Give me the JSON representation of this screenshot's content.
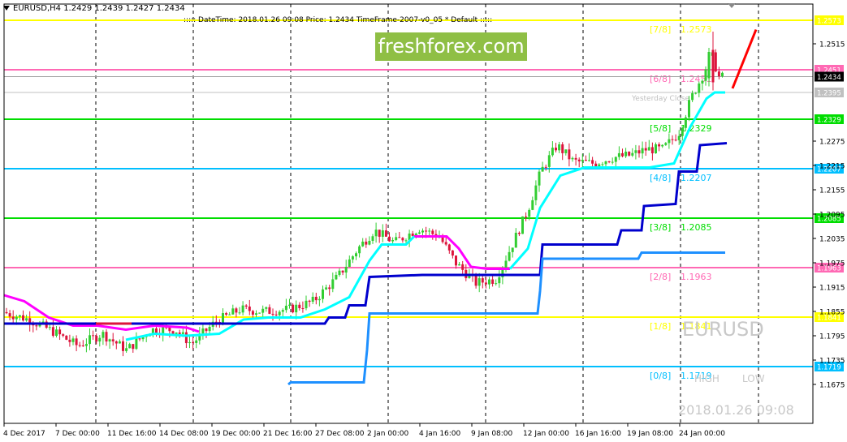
{
  "header": {
    "title": "EURUSD,H4  1.2429 1.2439 1.2427 1.2434",
    "info": "::::: DateTime: 2018.01.26 09:08   Price: 1.2434   TimeFrame-2007-v0_05    *   Default    :::::"
  },
  "brand": {
    "label": "freshforex.com",
    "color": "#8fbf45"
  },
  "watermark": {
    "symbol": "EURUSD",
    "high_label": "HIGH",
    "low_label": "LOW",
    "datetime": "2018.01.26 09:08"
  },
  "chart_data": {
    "type": "candlestick",
    "symbol": "EURUSD",
    "timeframe": "H4",
    "last_price": 1.2434,
    "ylim": [
      1.165,
      1.262
    ],
    "x_tick_labels": [
      "4 Dec 2017",
      "7 Dec 00:00",
      "11 Dec 16:00",
      "14 Dec 08:00",
      "19 Dec 00:00",
      "21 Dec 16:00",
      "27 Dec 08:00",
      "2 Jan 00:00",
      "4 Jan 16:00",
      "9 Jan 08:00",
      "12 Jan 00:00",
      "16 Jan 16:00",
      "19 Jan 08:00",
      "24 Jan 00:00"
    ],
    "y_tick_labels": [
      1.2515,
      1.2275,
      1.2215,
      1.2155,
      1.2095,
      1.2035,
      1.1975,
      1.1915,
      1.1855,
      1.1795,
      1.1735,
      1.1675
    ],
    "murrey_levels": [
      {
        "label": "[7/8]",
        "value": 1.2573,
        "color": "#ffff00"
      },
      {
        "label": "[6/8]",
        "value": 1.2451,
        "color": "#ff69b4"
      },
      {
        "label": "[5/8]",
        "value": 1.2329,
        "color": "#00dd00"
      },
      {
        "label": "[4/8]",
        "value": 1.2207,
        "color": "#00bfff"
      },
      {
        "label": "[3/8]",
        "value": 1.2085,
        "color": "#00dd00"
      },
      {
        "label": "[2/8]",
        "value": 1.1963,
        "color": "#ff69b4"
      },
      {
        "label": "[1/8]",
        "value": 1.1841,
        "color": "#ffff00"
      },
      {
        "label": "[0/8]",
        "value": 1.1719,
        "color": "#00bfff"
      }
    ],
    "level_value_labels": [
      "1.2573",
      "1.2451",
      "1.2329",
      "1.2207",
      "1.2085",
      "1.1963",
      "1.1841",
      "1.1719"
    ],
    "yesterday_close": {
      "label": "Yesterday Close",
      "value": 1.2395
    },
    "colors": {
      "bull": "#32cd32",
      "bear": "#dc143c",
      "trail_above": "#ff00ff",
      "trail_below": "#00ffff",
      "support1": "#0000cd",
      "support2": "#1e90ff",
      "projection": "#ff0000",
      "last_price_box": "#000000"
    }
  }
}
